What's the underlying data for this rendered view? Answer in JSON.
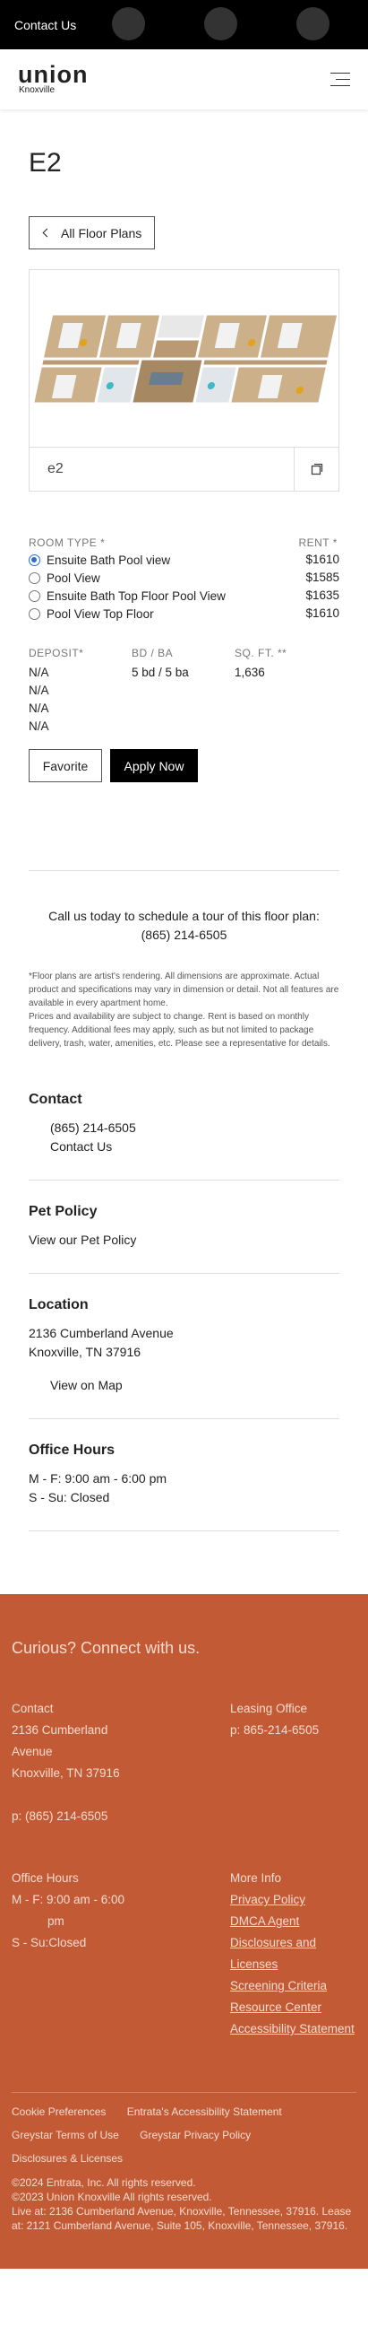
{
  "topbar": {
    "contact_label": "Contact Us"
  },
  "header": {
    "logo_word": "union",
    "logo_sub": "Knoxville"
  },
  "plan": {
    "title": "E2",
    "back_label": "All Floor Plans",
    "name": "e2"
  },
  "pricing": {
    "room_type_header": "ROOM TYPE *",
    "rent_header": "RENT *",
    "room_types": [
      {
        "label": "Ensuite Bath Pool view",
        "rent": "$1610",
        "selected": true
      },
      {
        "label": "Pool View",
        "rent": "$1585",
        "selected": false
      },
      {
        "label": "Ensuite Bath Top Floor Pool View",
        "rent": "$1635",
        "selected": false
      },
      {
        "label": "Pool View Top Floor",
        "rent": "$1610",
        "selected": false
      }
    ]
  },
  "details": {
    "deposit_header": "DEPOSIT*",
    "bdba_header": "BD / BA",
    "sqft_header": "SQ. FT. **",
    "deposits": [
      "N/A",
      "N/A",
      "N/A",
      "N/A"
    ],
    "bdba": "5 bd / 5 ba",
    "sqft": "1,636"
  },
  "actions": {
    "favorite_label": "Favorite",
    "apply_label": "Apply Now"
  },
  "call": {
    "text": "Call us today to schedule a tour of this floor plan:",
    "phone": "(865) 214-6505"
  },
  "disclaimer": {
    "line1": "*Floor plans are artist's rendering. All dimensions are approximate. Actual product and specifications may vary in dimension or detail. Not all features are available in every apartment home.",
    "line2": "Prices and availability are subject to change. Rent is based on monthly frequency. Additional fees may apply, such as but not limited to package delivery, trash, water, amenities, etc. Please see a representative for details."
  },
  "contact": {
    "heading": "Contact",
    "phone": "(865) 214-6505",
    "link": "Contact Us"
  },
  "pet": {
    "heading": "Pet Policy",
    "link": "View our Pet Policy"
  },
  "location": {
    "heading": "Location",
    "street": "2136 Cumberland Avenue",
    "city": "Knoxville, TN 37916",
    "map_link": "View on Map"
  },
  "hours": {
    "heading": "Office Hours",
    "weekday": "M - F:  9:00 am - 6:00 pm",
    "weekend": "S - Su:  Closed"
  },
  "footer": {
    "heading": "Curious? Connect with us.",
    "contact_title": "Contact",
    "address1": "2136 Cumberland",
    "address2": "Avenue",
    "address3": "Knoxville, TN 37916",
    "phone": "p: (865) 214-6505",
    "leasing_title": "Leasing Office",
    "leasing_phone": "p: 865-214-6505",
    "hours_title": "Office Hours",
    "hours_weekday": "M - F: 9:00 am - 6:00",
    "hours_weekday_pm": "pm",
    "hours_weekend": "S - Su:Closed",
    "more_title": "More Info",
    "more_links": [
      "Privacy Policy",
      "DMCA Agent",
      "Disclosures and Licenses",
      "Screening Criteria",
      "Resource Center",
      "Accessibility Statement"
    ],
    "bottom_links": [
      "Cookie Preferences",
      "Entrata's Accessibility Statement",
      "Greystar Terms of Use",
      "Greystar Privacy Policy",
      "Disclosures & Licenses"
    ],
    "copy1": "©2024 Entrata, Inc. All rights reserved.",
    "copy2": "©2023 Union Knoxville All rights reserved.",
    "copy3": "Live at: 2136 Cumberland Avenue, Knoxville, Tennessee, 37916.  Lease at: 2121 Cumberland Avenue, Suite 105, Knoxville, Tennessee, 37916."
  },
  "colors": {
    "footer_bg": "#c35a36",
    "accent": "#000000",
    "radio": "#2a6bd6"
  }
}
